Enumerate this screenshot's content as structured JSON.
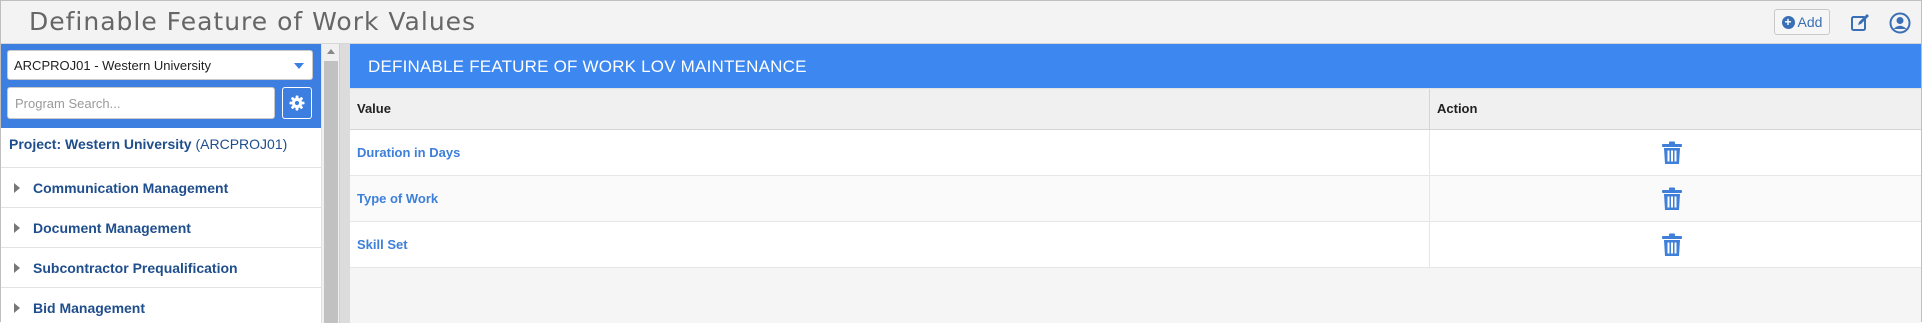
{
  "header": {
    "title": "Definable Feature of Work Values",
    "add_label": "Add",
    "icons": [
      "add-circle-icon",
      "edit-icon",
      "user-icon"
    ]
  },
  "sidebar": {
    "project_select": "ARCPROJ01 - Western University",
    "search_placeholder": "Program Search...",
    "project_label": "Project: Western University",
    "project_code": "(ARCPROJ01)",
    "items": [
      {
        "label": "Communication Management"
      },
      {
        "label": "Document Management"
      },
      {
        "label": "Subcontractor Prequalification"
      },
      {
        "label": "Bid Management"
      }
    ]
  },
  "main": {
    "banner_title": "DEFINABLE FEATURE OF WORK LOV MAINTENANCE",
    "columns": [
      "Value",
      "Action"
    ],
    "rows": [
      {
        "value": "Duration in Days"
      },
      {
        "value": "Type of Work"
      },
      {
        "value": "Skill Set"
      }
    ]
  },
  "colors": {
    "accent": "#3d87f0",
    "sidebar_accent": "#3d7fe0",
    "link": "#3d7fd9",
    "nav_text": "#1f4e8c"
  }
}
